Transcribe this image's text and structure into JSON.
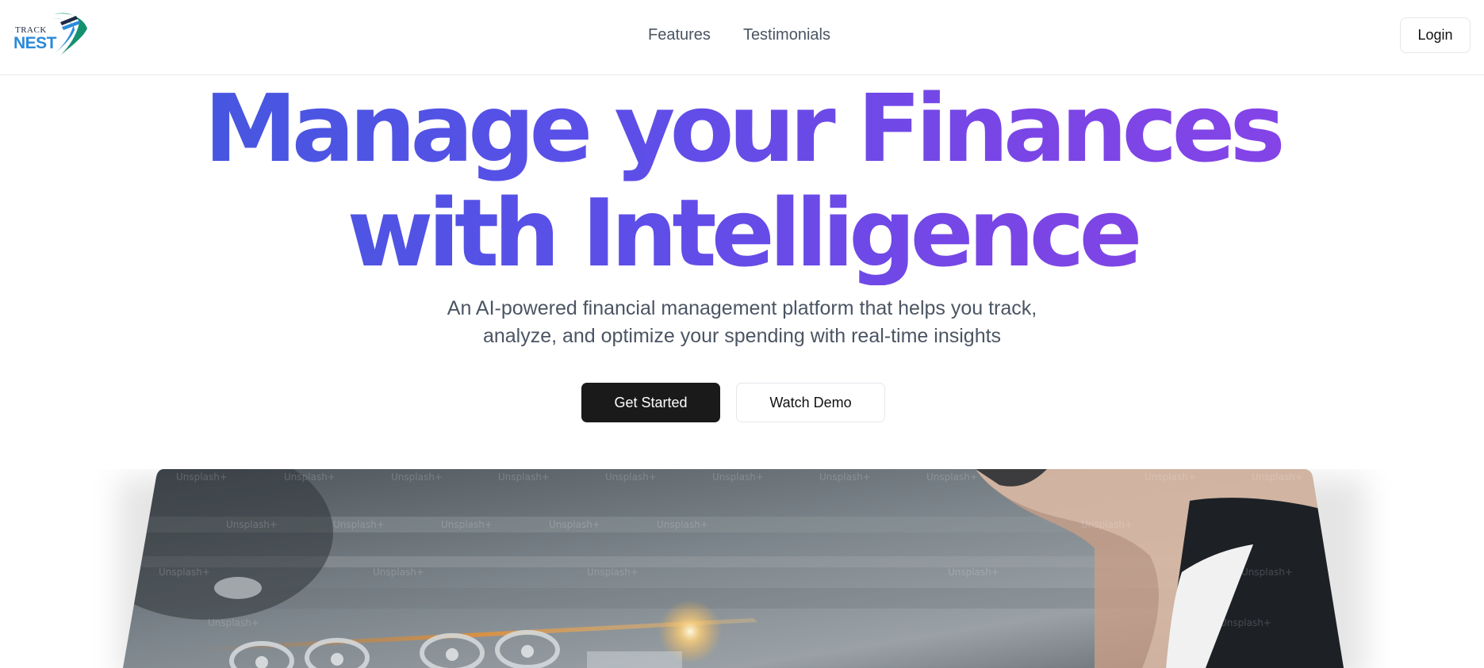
{
  "brand": {
    "logo_top": "TRACK",
    "logo_bottom": "NEST",
    "accent": "#2b8ad8",
    "accent_secondary": "#14916f"
  },
  "nav": {
    "links": [
      {
        "label": "Features"
      },
      {
        "label": "Testimonials"
      }
    ],
    "login_label": "Login"
  },
  "hero": {
    "title_line1": "Manage your Finances",
    "title_line2": "with Intelligence",
    "subtitle_line1": "An AI-powered financial management platform that helps you track,",
    "subtitle_line2": "analyze, and optimize your spending with real-time insights",
    "primary_cta": "Get Started",
    "secondary_cta": "Watch Demo",
    "gradient_start": "#3b5bdb",
    "gradient_end": "#8b44e8",
    "image_watermark": "Unsplash+"
  }
}
